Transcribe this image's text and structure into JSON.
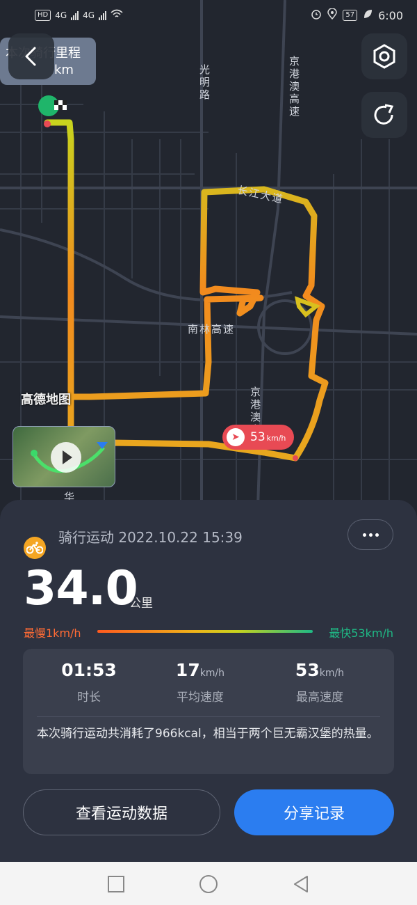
{
  "status_bar": {
    "network_a": "4G",
    "network_b": "4G",
    "battery": "57",
    "time": "6:00"
  },
  "map": {
    "bubble_line1": "本次骑行里程",
    "bubble_line2": "km",
    "labels": {
      "guangming": "光明路",
      "jinggangao_top": "京港澳高速",
      "changjiang": "长江大道",
      "nanlin": "南林高速",
      "jinggangao_bottom": "京港澳高速",
      "hua": "华"
    },
    "watermark": "高德地图",
    "max_speed_value": "53",
    "max_speed_unit": "km/h"
  },
  "summary": {
    "activity_title": "骑行运动 2022.10.22 15:39",
    "distance": "34.0",
    "distance_unit": "公里",
    "slowest": "最慢1km/h",
    "fastest": "最快53km/h",
    "stats": [
      {
        "value": "01:53",
        "unit": "",
        "label": "时长"
      },
      {
        "value": "17",
        "unit": "km/h",
        "label": "平均速度"
      },
      {
        "value": "53",
        "unit": "km/h",
        "label": "最高速度"
      }
    ],
    "note": "本次骑行运动共消耗了966kcal，相当于两个巨无霸汉堡的热量。"
  },
  "buttons": {
    "view_data": "查看运动数据",
    "share": "分享记录"
  },
  "colors": {
    "accent_blue": "#2b7df0",
    "slow_orange": "#ff6b35",
    "fast_green": "#1fb985",
    "speed_tag_red": "#e84a54"
  }
}
